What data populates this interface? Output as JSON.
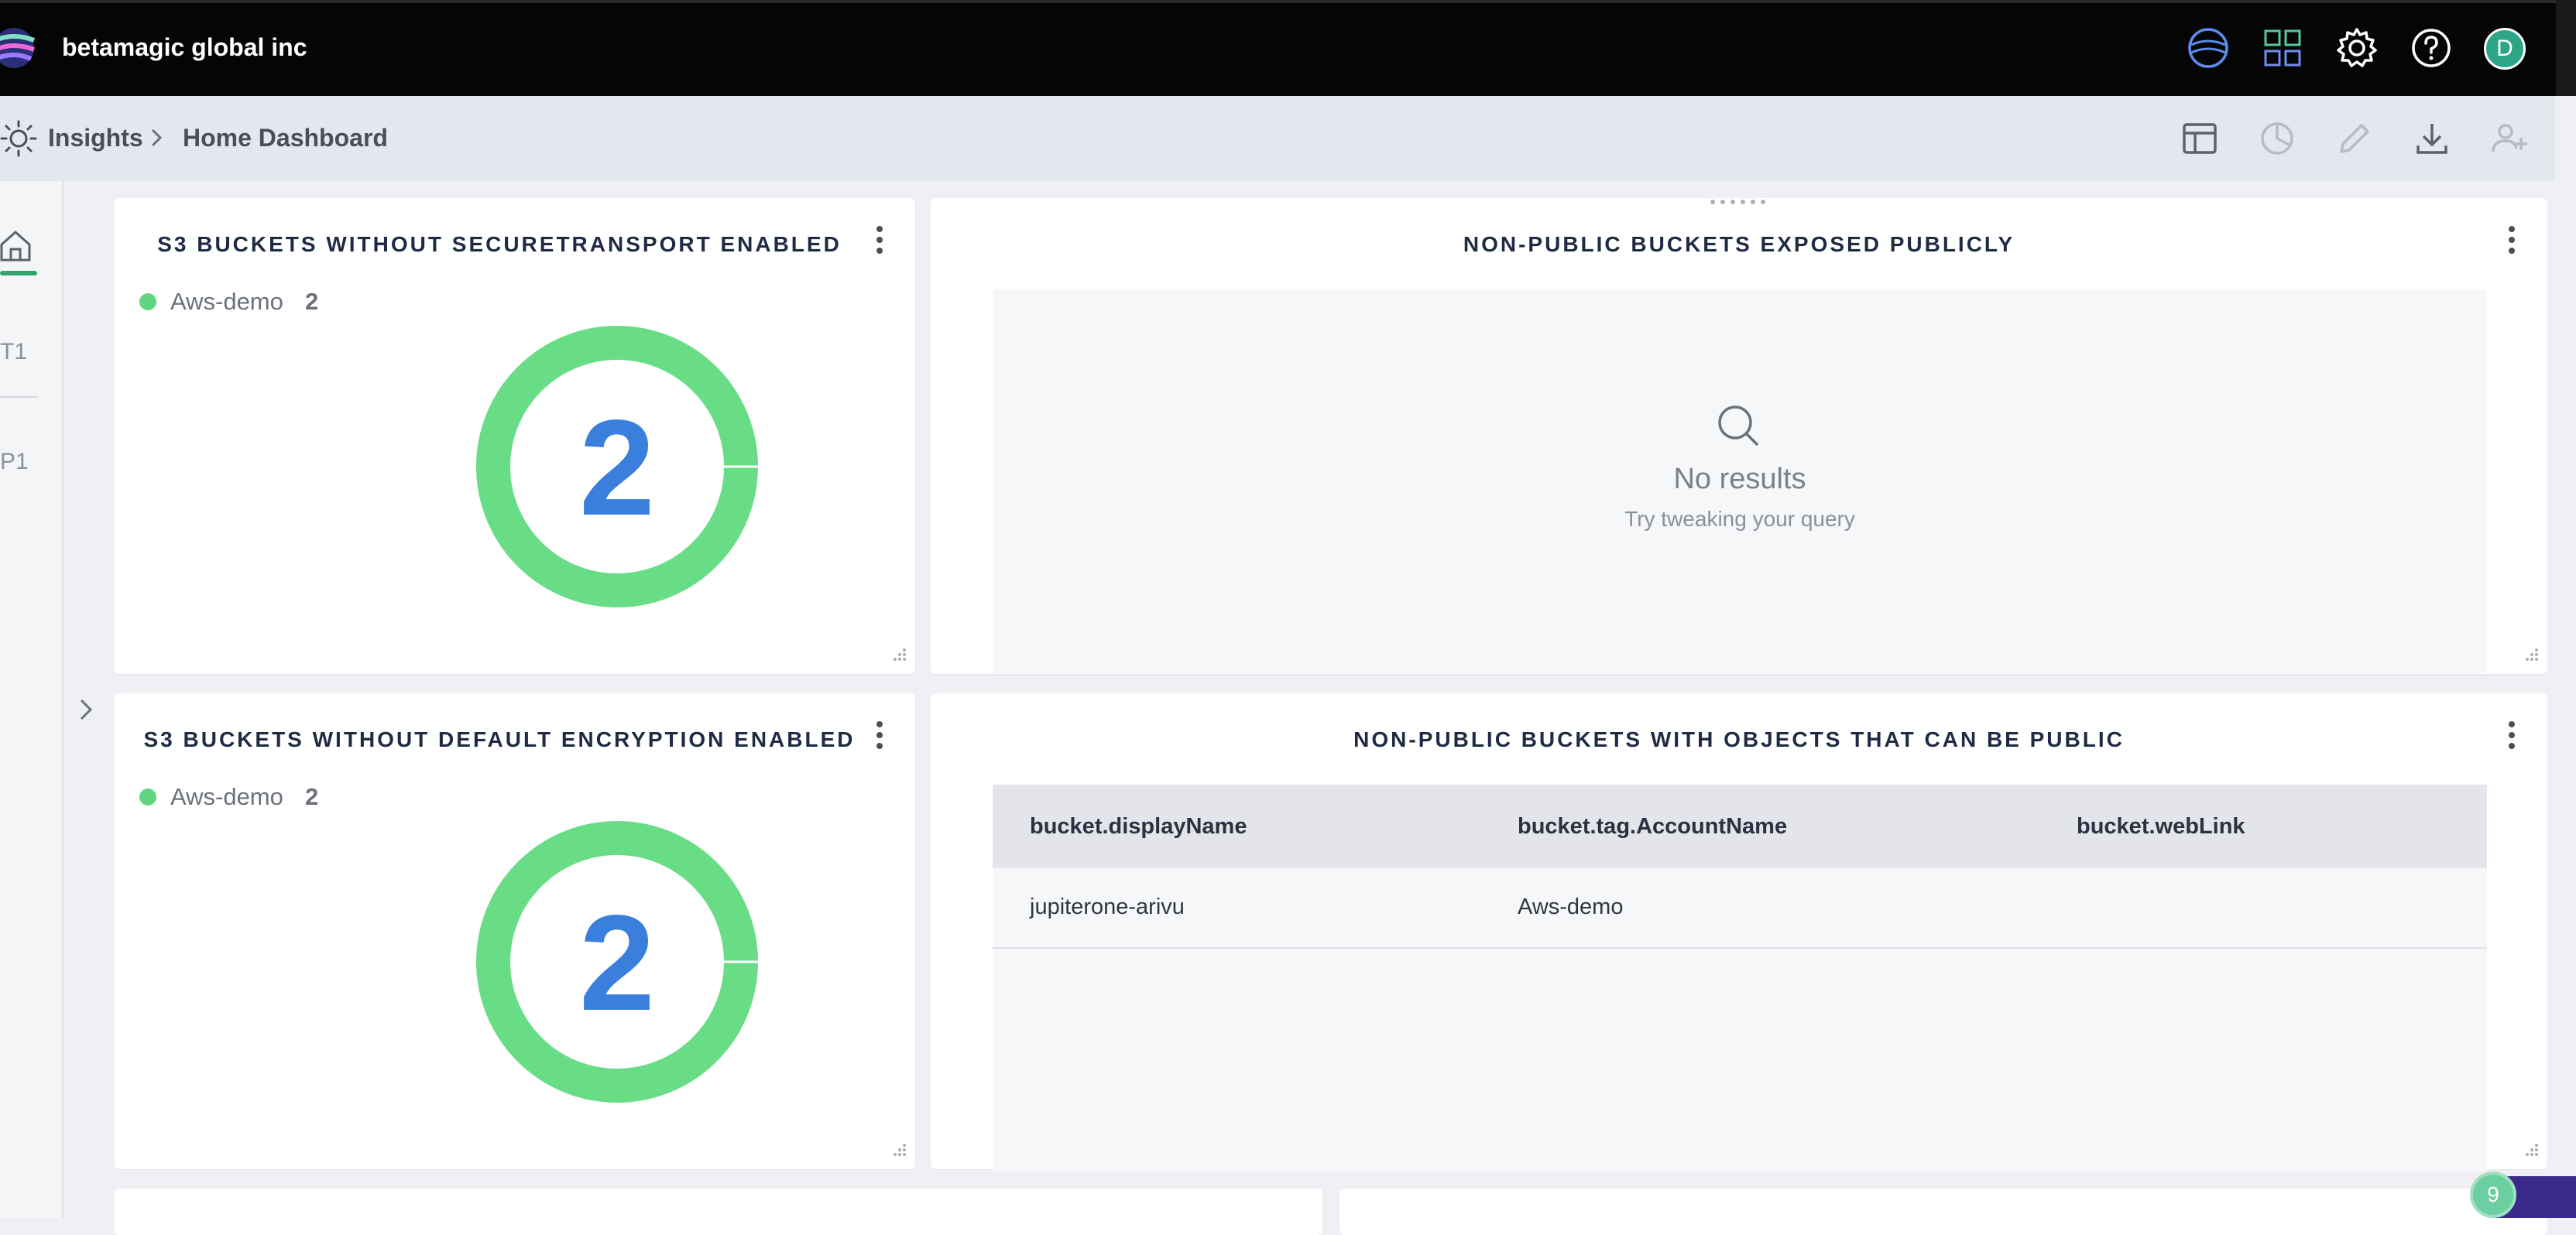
{
  "header": {
    "org_name": "betamagic global inc",
    "avatar_initial": "D",
    "icons": [
      "jupiterone-logo-icon",
      "apps-grid-icon",
      "gear-icon",
      "help-icon"
    ]
  },
  "breadcrumb": {
    "root": "Insights",
    "current": "Home Dashboard",
    "actions": [
      "layout-icon",
      "pie-chart-icon",
      "pencil-icon",
      "download-icon",
      "add-user-icon"
    ]
  },
  "rail": {
    "items": [
      "T1",
      "P1"
    ]
  },
  "panels": {
    "secure_transport": {
      "title": "S3 BUCKETS WITHOUT SECURETRANSPORT ENABLED",
      "legend_label": "Aws-demo",
      "legend_count": "2",
      "center_value": "2",
      "chart_data": {
        "type": "pie",
        "categories": [
          "Aws-demo"
        ],
        "values": [
          2
        ]
      }
    },
    "exposed_publicly": {
      "title": "NON-PUBLIC BUCKETS EXPOSED PUBLICLY",
      "empty_title": "No results",
      "empty_sub": "Try tweaking your query"
    },
    "default_encryption": {
      "title": "S3 BUCKETS WITHOUT DEFAULT ENCRYPTION ENABLED",
      "legend_label": "Aws-demo",
      "legend_count": "2",
      "center_value": "2",
      "chart_data": {
        "type": "pie",
        "categories": [
          "Aws-demo"
        ],
        "values": [
          2
        ]
      }
    },
    "objects_public": {
      "title": "NON-PUBLIC BUCKETS WITH OBJECTS THAT CAN BE PUBLIC",
      "columns": [
        "bucket.displayName",
        "bucket.tag.AccountName",
        "bucket.webLink"
      ],
      "rows": [
        [
          "jupiterone-arivu",
          "Aws-demo",
          ""
        ]
      ]
    }
  },
  "colors": {
    "accent_green": "#5fd67f",
    "value_blue": "#3a7fdc",
    "header_bg": "#050505"
  },
  "notification_count": "9"
}
